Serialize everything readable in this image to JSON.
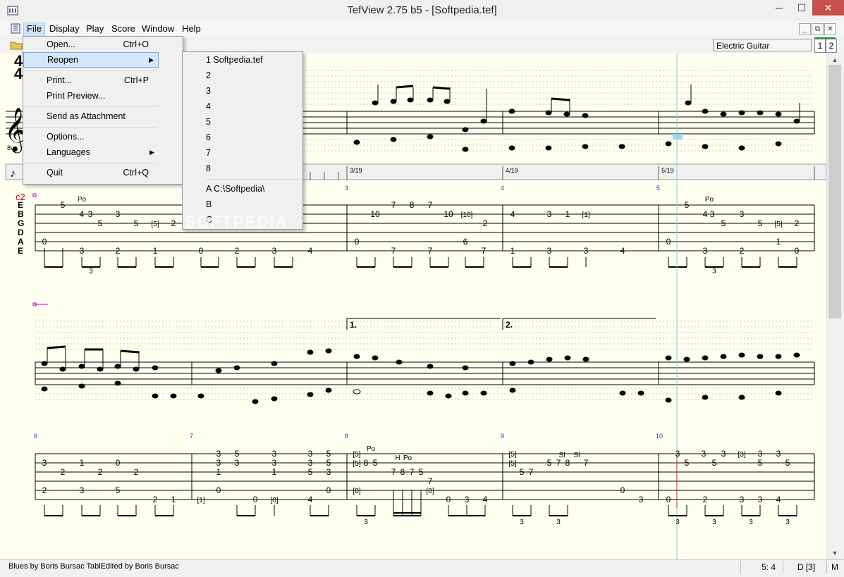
{
  "window": {
    "title": "TefView 2.75 b5  - [Softpedia.tef]",
    "minimize": "─",
    "maximize": "☐",
    "close": "✕"
  },
  "menubar": [
    "File",
    "Display",
    "Play",
    "Score",
    "Window",
    "Help"
  ],
  "mdi_buttons": [
    "_",
    "⧉",
    "✕"
  ],
  "toolbar": {
    "instrument": "Electric Guitar",
    "tracks": [
      "1",
      "2"
    ],
    "accent": "#1c9a2b"
  },
  "file_menu": [
    {
      "label": "Open...",
      "shortcut": "Ctrl+O"
    },
    {
      "label": "Reopen",
      "submenu": true
    },
    {
      "label": "Print...",
      "shortcut": "Ctrl+P"
    },
    {
      "label": "Print Preview..."
    },
    {
      "label": "Send as Attachment"
    },
    {
      "label": "Options..."
    },
    {
      "label": "Languages",
      "submenu": true
    },
    {
      "label": "Quit",
      "shortcut": "Ctrl+Q"
    }
  ],
  "reopen_menu": [
    "1 Softpedia.tef",
    "2",
    "3",
    "4",
    "5",
    "6",
    "7",
    "8",
    "A C:\\Softpedia\\",
    "B",
    "C"
  ],
  "watermark": "SOFTPEDIA",
  "score": {
    "clef_octave": "8va",
    "tuning": [
      "E",
      "B",
      "G",
      "D",
      "A",
      "E"
    ],
    "track_label": "c2",
    "time_markers": [
      "3/19",
      "4/19",
      "5/19"
    ],
    "system1_measures": [
      "3",
      "4",
      "5"
    ],
    "system2_measures": [
      "6",
      "7",
      "8",
      "9",
      "10"
    ],
    "endings": [
      "1.",
      "2."
    ],
    "technique_po": "Po",
    "technique_h": "H",
    "technique_sl": "Sl",
    "triplet": "3",
    "tab1": [
      [
        "5",
        "4",
        "3",
        "3",
        "5",
        "5",
        "[5]",
        "2",
        "0",
        "3",
        "2",
        "1",
        "0",
        "2",
        "3",
        "4"
      ],
      [
        "7",
        "8",
        "7",
        "10",
        "10",
        "[10]",
        "2",
        "0",
        "7",
        "7",
        "6",
        "7"
      ],
      [
        "4",
        "3",
        "1",
        "[1]",
        "1",
        "3",
        "3",
        "4"
      ],
      [
        "5",
        "4",
        "3",
        "3",
        "5",
        "5",
        "[5]",
        "2",
        "0",
        "3",
        "2",
        "1",
        "0"
      ]
    ],
    "tab2": [
      [
        "3",
        "2",
        "1",
        "2",
        "0",
        "2",
        "2",
        "3",
        "5",
        "2",
        "1"
      ],
      [
        "3",
        "3",
        "3",
        "1",
        "3",
        "3",
        "1",
        "3",
        "3",
        "0",
        "[1]",
        "0",
        "[0]",
        "4",
        "5",
        "5",
        "3",
        "5",
        "5",
        "0"
      ],
      [
        "[5]",
        "[5]",
        "8",
        "5",
        "7",
        "8",
        "7",
        "5",
        "[0]",
        "[0]",
        "7",
        "0",
        "3",
        "4"
      ],
      [
        "[5]",
        "[5]",
        "5",
        "7",
        "5",
        "7",
        "8",
        "7",
        "0",
        "3"
      ],
      [
        "3",
        "3",
        "3",
        "[3]",
        "3",
        "3",
        "5",
        "5",
        "5",
        "5",
        "0",
        "2",
        "3",
        "3",
        "4"
      ]
    ]
  },
  "statusbar": {
    "text": "Blues  by Boris Bursac  TablEdited by Boris Bursac",
    "position": "5: 4",
    "key": "D [3]",
    "mode": "M"
  }
}
